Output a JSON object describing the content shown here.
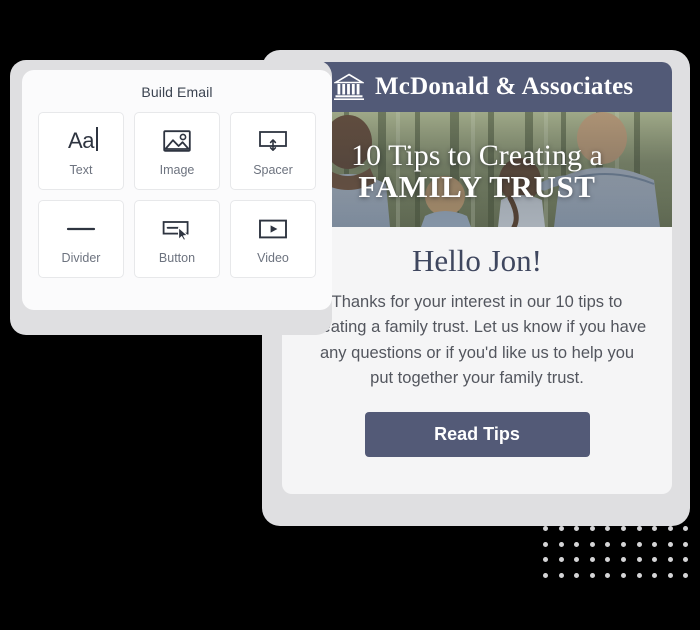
{
  "builder": {
    "title": "Build Email",
    "blocks": [
      {
        "label": "Text",
        "icon": "text-icon",
        "glyph": "Aa"
      },
      {
        "label": "Image",
        "icon": "image-icon",
        "glyph": ""
      },
      {
        "label": "Spacer",
        "icon": "spacer-icon",
        "glyph": ""
      },
      {
        "label": "Divider",
        "icon": "divider-icon",
        "glyph": ""
      },
      {
        "label": "Button",
        "icon": "button-icon",
        "glyph": ""
      },
      {
        "label": "Video",
        "icon": "video-icon",
        "glyph": ""
      }
    ]
  },
  "email": {
    "header": {
      "brand": "McDonald & Associates",
      "icon": "bank-building-icon",
      "background_color": "#525a77"
    },
    "hero": {
      "line1": "10 Tips to Creating a",
      "line2": "FAMILY TRUST",
      "image_alt": "family-in-forest-photo"
    },
    "body": {
      "greeting": "Hello Jon!",
      "paragraph": "Thanks for your interest in our 10 tips to creating a family trust. Let us know if you have any questions or if you'd like us to help you put together your family trust."
    },
    "cta": {
      "label": "Read Tips",
      "background_color": "#535a77",
      "text_color": "#ffffff"
    }
  },
  "decor": {
    "dot_color": "#d4d4d6",
    "dot_columns": 10,
    "dot_rows": 9,
    "canvas_color": "#dfdfe1"
  }
}
